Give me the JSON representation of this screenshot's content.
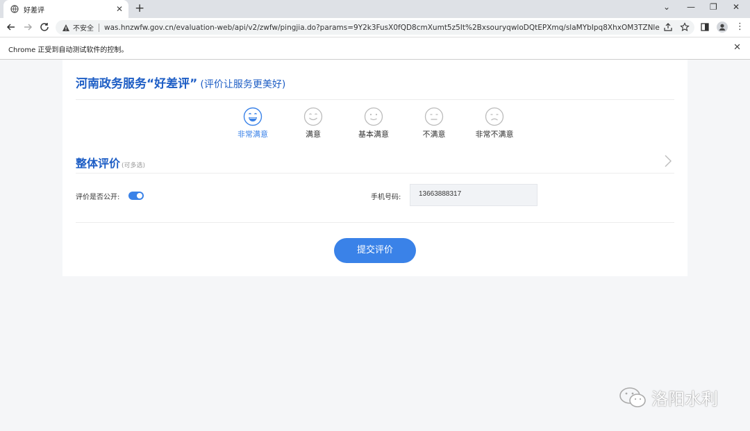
{
  "browser": {
    "tab_title": "好差评",
    "security_label": "不安全",
    "url": "was.hnzwfw.gov.cn/evaluation-web/api/v2/zwfw/pingjia.do?params=9Y2k3FusX0fQD8cmXumt5z5It%2BxsouryqwloDQtEPXmq/slaMYbIpq8XhxOM3TZNleM...",
    "infobar_message": "Chrome 正受到自动测试软件的控制。"
  },
  "page": {
    "heading": "河南政务服务“好差评”",
    "heading_sub": "(评价让服务更美好)",
    "ratings": [
      {
        "label": "非常满意",
        "icon": "very-satisfied-face-icon"
      },
      {
        "label": "满意",
        "icon": "satisfied-face-icon"
      },
      {
        "label": "基本满意",
        "icon": "basic-satisfied-face-icon"
      },
      {
        "label": "不满意",
        "icon": "dissatisfied-face-icon"
      },
      {
        "label": "非常不满意",
        "icon": "very-dissatisfied-face-icon"
      }
    ],
    "selected_rating": "非常满意",
    "section_title": "整体评价",
    "section_hint": "(可多选)",
    "public_label": "评价是否公开:",
    "public_toggle_on": true,
    "phone_label": "手机号码:",
    "phone_value": "13663888317",
    "submit_label": "提交评价"
  },
  "watermark": {
    "text": "洛阳水利"
  },
  "colors": {
    "accent": "#3a82e8",
    "heading": "#1e5ec5"
  }
}
